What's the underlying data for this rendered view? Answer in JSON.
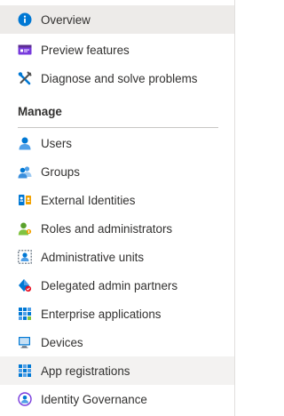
{
  "nav": {
    "top_items": [
      {
        "label": "Overview",
        "icon": "info-icon",
        "state": "selected"
      },
      {
        "label": "Preview features",
        "icon": "preview-features-icon"
      },
      {
        "label": "Diagnose and solve problems",
        "icon": "diagnose-tools-icon"
      }
    ],
    "manage_header": "Manage",
    "manage_items": [
      {
        "label": "Users",
        "icon": "user-icon"
      },
      {
        "label": "Groups",
        "icon": "groups-icon"
      },
      {
        "label": "External Identities",
        "icon": "external-identities-icon"
      },
      {
        "label": "Roles and administrators",
        "icon": "roles-admin-icon"
      },
      {
        "label": "Administrative units",
        "icon": "admin-units-icon"
      },
      {
        "label": "Delegated admin partners",
        "icon": "delegated-admin-icon"
      },
      {
        "label": "Enterprise applications",
        "icon": "enterprise-apps-icon"
      },
      {
        "label": "Devices",
        "icon": "devices-icon"
      },
      {
        "label": "App registrations",
        "icon": "app-registrations-icon",
        "state": "hover"
      },
      {
        "label": "Identity Governance",
        "icon": "identity-governance-icon"
      }
    ]
  },
  "colors": {
    "accent": "#0078d4",
    "selected_bg": "#edebe9",
    "hover_bg": "#f3f2f1",
    "text": "#323130"
  }
}
